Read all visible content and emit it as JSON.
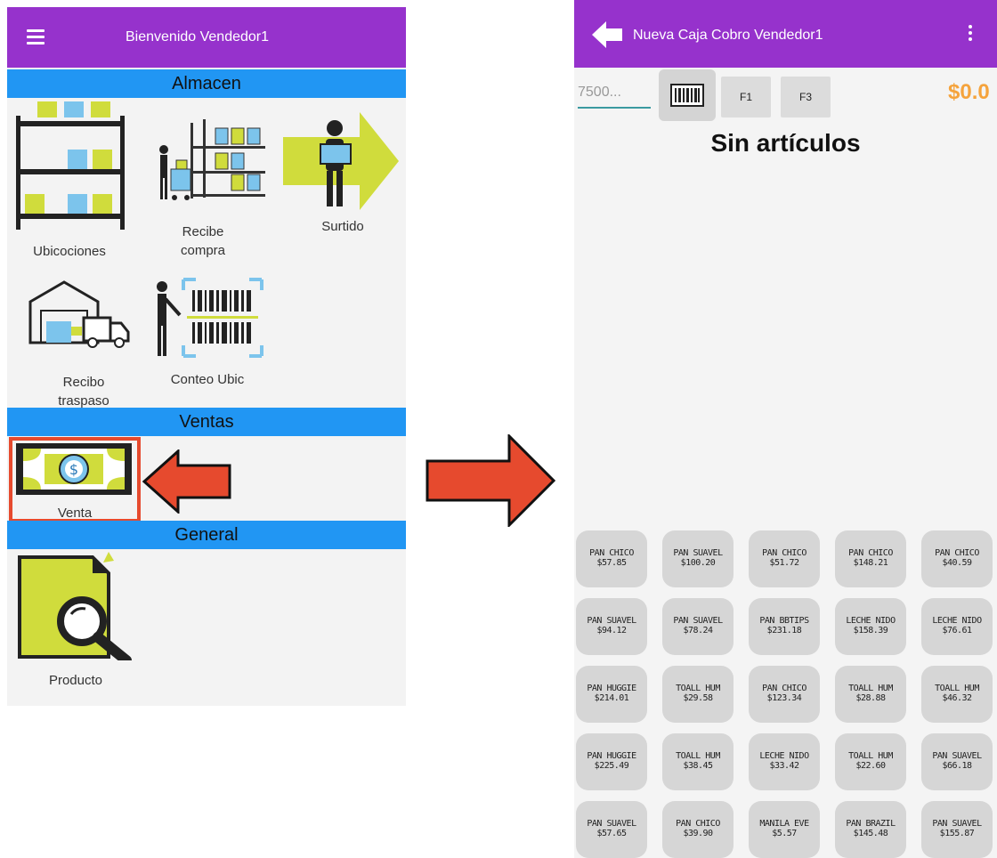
{
  "left_screen": {
    "appbar_title": "Bienvenido Vendedor1",
    "sections": {
      "almacen": "Almacen",
      "ventas": "Ventas",
      "general": "General"
    },
    "tiles": {
      "ubicaciones": "Ubicociones",
      "recibe_compra_1": "Recibe",
      "recibe_compra_2": "compra",
      "surtido": "Surtido",
      "recibo_traspaso_1": "Recibo",
      "recibo_traspaso_2": "traspaso",
      "conteo_ubic": "Conteo Ubic",
      "venta": "Venta",
      "producto": "Producto"
    }
  },
  "right_screen": {
    "appbar_title": "Nueva Caja Cobro Vendedor1",
    "search_value": "7500...",
    "f1_label": "F1",
    "f3_label": "F3",
    "total": "$0.0",
    "empty_message": "Sin artículos",
    "products": [
      {
        "name": "PAN CHICO",
        "price": "$57.85"
      },
      {
        "name": "PAN SUAVEL",
        "price": "$100.20"
      },
      {
        "name": "PAN CHICO",
        "price": "$51.72"
      },
      {
        "name": "PAN CHICO",
        "price": "$148.21"
      },
      {
        "name": "PAN CHICO",
        "price": "$40.59"
      },
      {
        "name": "PAN SUAVEL",
        "price": "$94.12"
      },
      {
        "name": "PAN SUAVEL",
        "price": "$78.24"
      },
      {
        "name": "PAN BBTIPS",
        "price": "$231.18"
      },
      {
        "name": "LECHE NIDO",
        "price": "$158.39"
      },
      {
        "name": "LECHE NIDO",
        "price": "$76.61"
      },
      {
        "name": "PAN HUGGIE",
        "price": "$214.01"
      },
      {
        "name": "TOALL HUM",
        "price": "$29.58"
      },
      {
        "name": "PAN CHICO",
        "price": "$123.34"
      },
      {
        "name": "TOALL HUM",
        "price": "$28.88"
      },
      {
        "name": "TOALL HUM",
        "price": "$46.32"
      },
      {
        "name": "PAN HUGGIE",
        "price": "$225.49"
      },
      {
        "name": "TOALL HUM",
        "price": "$38.45"
      },
      {
        "name": "LECHE NIDO",
        "price": "$33.42"
      },
      {
        "name": "TOALL HUM",
        "price": "$22.60"
      },
      {
        "name": "PAN SUAVEL",
        "price": "$66.18"
      },
      {
        "name": "PAN SUAVEL",
        "price": "$57.65"
      },
      {
        "name": "PAN CHICO",
        "price": "$39.90"
      },
      {
        "name": "MANILA EVE",
        "price": "$5.57"
      },
      {
        "name": "PAN BRAZIL",
        "price": "$145.48"
      },
      {
        "name": "PAN SUAVEL",
        "price": "$155.87"
      }
    ]
  },
  "colors": {
    "appbar": "#9632cc",
    "section_header": "#2196f3",
    "highlight": "#e64a2e",
    "total": "#f5a33c",
    "icon_green": "#d0dc3c",
    "icon_blue": "#7cc4ec"
  }
}
